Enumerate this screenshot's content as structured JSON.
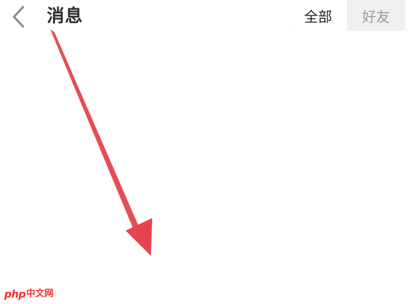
{
  "header": {
    "back_icon": "chevron-left-icon",
    "title": "消息"
  },
  "filter": {
    "options": [
      "全部",
      "好友"
    ],
    "selected": "全部"
  },
  "watermark": {
    "php": "php",
    "site": "中文网"
  },
  "colors": {
    "arrow": "#e5444c",
    "title": "#2b2b2b",
    "active_text": "#222222",
    "inactive_text": "#9a9a9a",
    "watermark": "#ff2d2d"
  }
}
